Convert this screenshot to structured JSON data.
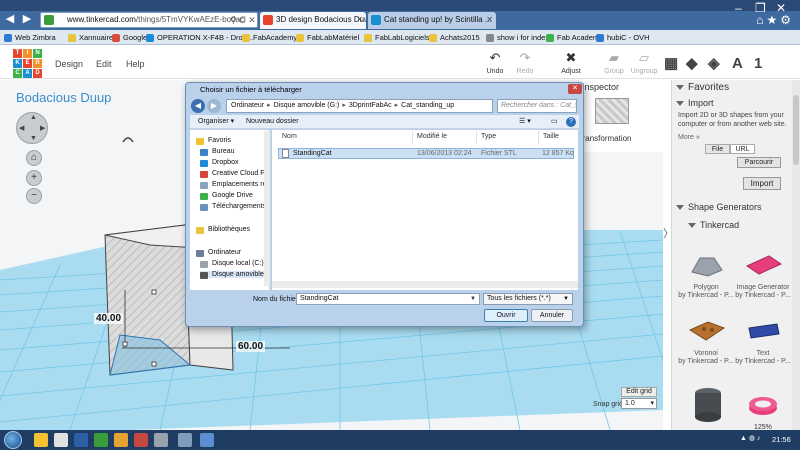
{
  "browser": {
    "url_host": "www.tinkercad.com",
    "url_path": "/things/5TmVYKwAEzE-bodaci",
    "url_icons": "⚲ C ✕",
    "tabs": [
      {
        "label": "3D design Bodacious Duup ..."
      },
      {
        "label": "Cat standing up! by Scintilla ..."
      }
    ],
    "bookmarks": [
      "Web Zimbra",
      "Xannuaire",
      "Google",
      "OPERATION X-F4B - Drop...",
      "FabAcademy",
      "FabLabMatériel",
      "FabLabLogiciels",
      "Achats2015",
      "show i for index",
      "Fab Academy",
      "hubiC - OVH"
    ]
  },
  "app": {
    "logo_letters": [
      "TIN",
      "KER",
      "CAD"
    ],
    "menu": [
      "Design",
      "Edit",
      "Help"
    ],
    "design_title": "Bodacious Duup",
    "tools": {
      "undo": "Undo",
      "redo": "Redo",
      "adjust": "Adjust",
      "group": "Group",
      "ungroup": "Ungroup"
    },
    "view_icons": {
      "a": "A",
      "one": "1"
    },
    "inspector": {
      "title": "Inspector",
      "label": "Transformation"
    },
    "edit_grid_label": "Edit grid",
    "snap_grid_label": "Snap grid",
    "snap_grid_value": "1.0",
    "dimensions": {
      "depth": "40.00",
      "width": "60.00"
    },
    "zoom_level": "125%"
  },
  "sidebar": {
    "favorites": "Favorites",
    "import": {
      "title": "Import",
      "description": "Import 2D or 3D shapes from your computer or from another web site.",
      "more": "More »",
      "tab_file": "File",
      "tab_url": "URL",
      "browse_label": "Parcourir",
      "import_button": "Import"
    },
    "shape_generators": "Shape Generators",
    "tinkercad_section": "Tinkercad",
    "shapes": [
      {
        "name": "Polygon",
        "author": "by Tinkercad - P..."
      },
      {
        "name": "Image Generator",
        "author": "by Tinkercad - P..."
      },
      {
        "name": "Voronoi",
        "author": "by Tinkercad - P..."
      },
      {
        "name": "Text",
        "author": "by Tinkercad - P..."
      }
    ]
  },
  "dialog": {
    "title": "Choisir un fichier à télécharger",
    "path": [
      "Ordinateur",
      "Disque amovible (G:)",
      "3DprintFabAc",
      "Cat_standing_up"
    ],
    "search_placeholder": "Rechercher dans : Cat_s...",
    "toolbar": {
      "organize": "Organiser ▾",
      "new_folder": "Nouveau dossier"
    },
    "nav": {
      "favorites": "Favoris",
      "favorites_items": [
        "Bureau",
        "Dropbox",
        "Creative Cloud Fil",
        "Emplacements réc",
        "Google Drive",
        "Téléchargements"
      ],
      "libraries": "Bibliothèques",
      "computer": "Ordinateur",
      "computer_items": [
        "Disque local (C:)",
        "Disque amovible"
      ]
    },
    "columns": {
      "name": "Nom",
      "modified": "Modifié le",
      "type": "Type",
      "size": "Taille"
    },
    "files": [
      {
        "name": "StandingCat",
        "modified": "13/06/2013 02:24",
        "type": "Fichier STL",
        "size": "12 857 Ko"
      }
    ],
    "filename_label": "Nom du fichier :",
    "filename_value": "StandingCat",
    "filetype_value": "Tous les fichiers (*.*)",
    "open_button": "Ouvrir",
    "cancel_button": "Annuler"
  },
  "taskbar": {
    "clock": "21:56"
  },
  "colors": {
    "accent": "#3a8ecb",
    "grid_blue": "#74c6e8",
    "logo_red": "#e7452e",
    "logo_orange": "#f2912a",
    "logo_green": "#3bb24a",
    "logo_blue": "#1c8ed2"
  }
}
